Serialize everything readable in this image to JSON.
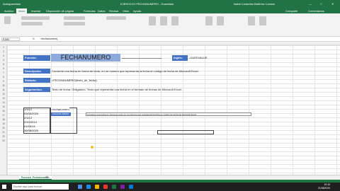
{
  "titlebar": {
    "autosave": "Autoguardado",
    "filename": "EJERCICIO FECHANUMERO - Guardado",
    "user": "Isabel Lizandra Martínez Lozano",
    "window_controls": [
      "—",
      "□",
      "✕"
    ]
  },
  "ribbon_tabs": [
    "Archivo",
    "Inicio",
    "Insertar",
    "Disposición de página",
    "Fórmulas",
    "Datos",
    "Revisar",
    "Vista",
    "Ayuda"
  ],
  "ribbon_actions": {
    "share": "Compartir",
    "comments": "Comentarios"
  },
  "formula_bar": {
    "name_box": "E16M",
    "fx": "fx",
    "content": "=fechanumero("
  },
  "sheet": {
    "rows": [
      "1",
      "2",
      "3",
      "4",
      "5",
      "6",
      "7",
      "8",
      "9",
      "10",
      "11",
      "12",
      "13",
      "14",
      "15",
      "16",
      "17",
      "18",
      "19",
      "20",
      "21",
      "22",
      "23"
    ],
    "funcion_label": "Función:",
    "funcion_name": "FECHANUMERO",
    "ingles_label": "Inglés:",
    "ingles_value": "=DATEVALUE",
    "descripcion_label": "Descripción",
    "descripcion_text": "Convierte una fecha en forma de texto, en un número que representa la fecha en código de fecha de Microsoft Excel.",
    "sintaxis_label": "Sintaxis:",
    "sintaxis_text": "=FECHANUMERO(texto_de_fecha)",
    "argumentos_label": "Argumentos:",
    "argumentos_text": "Texto de fecha: Obligatorio. Texto que representa una fecha en el formato de fechas de Microsoft Excel.",
    "dates": [
      "1/9/12",
      "03/05/2020",
      "2/3/13",
      "2/10/2014",
      "01/05/14",
      "26/08/2020"
    ],
    "formula_cell": "=fechanumero",
    "autocomplete": "FECHANUMERO",
    "tooltip": "Convierte una fecha en forma de texto en un número que representa la fecha en código de fecha de Microsoft Excel"
  },
  "sheet_tab": "Función_Fechanumero",
  "taskbar": {
    "search_placeholder": "Escribe aquí para buscar",
    "time": "19:16",
    "date": "21/08/2020"
  },
  "colors": {
    "excel_green": "#217346",
    "label_blue": "#4472c4",
    "title_fill": "#8ea9db"
  }
}
